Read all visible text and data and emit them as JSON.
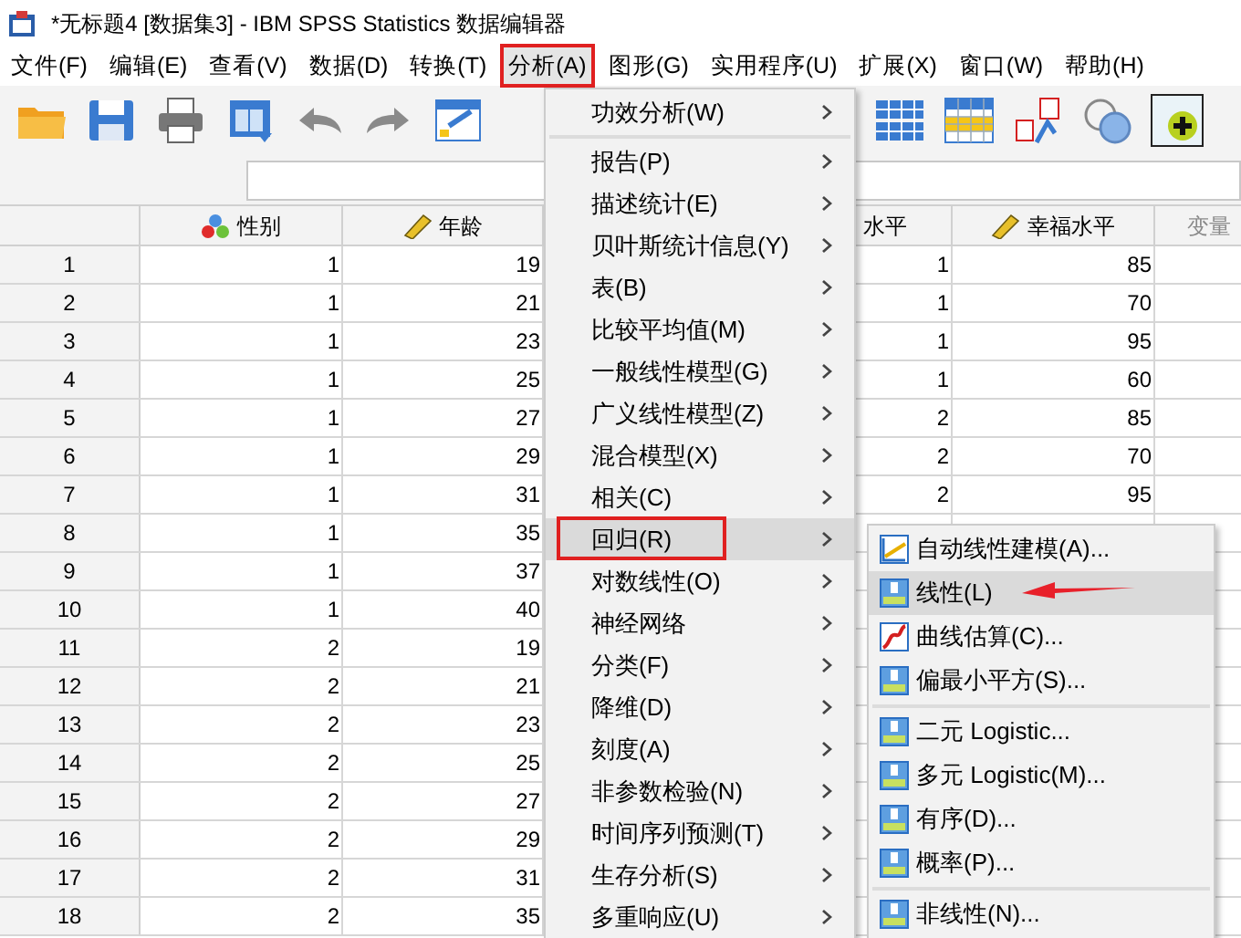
{
  "window": {
    "title": "*无标题4 [数据集3] - IBM SPSS Statistics 数据编辑器"
  },
  "menubar": [
    {
      "label": "文件(F)",
      "selected": false
    },
    {
      "label": "编辑(E)",
      "selected": false
    },
    {
      "label": "查看(V)",
      "selected": false
    },
    {
      "label": "数据(D)",
      "selected": false
    },
    {
      "label": "转换(T)",
      "selected": false
    },
    {
      "label": "分析(A)",
      "selected": true
    },
    {
      "label": "图形(G)",
      "selected": false
    },
    {
      "label": "实用程序(U)",
      "selected": false
    },
    {
      "label": "扩展(X)",
      "selected": false
    },
    {
      "label": "窗口(W)",
      "selected": false
    },
    {
      "label": "帮助(H)",
      "selected": false
    }
  ],
  "grid": {
    "columns": [
      {
        "label": "性别",
        "kind": "nominal"
      },
      {
        "label": "年龄",
        "kind": "scale"
      },
      {
        "label": "水平",
        "kind": "plain"
      },
      {
        "label": "幸福水平",
        "kind": "scale"
      },
      {
        "label": "变量",
        "kind": "empty"
      }
    ],
    "rows": [
      {
        "number": "1",
        "cells": [
          "1",
          "19",
          "1",
          "85"
        ]
      },
      {
        "number": "2",
        "cells": [
          "1",
          "21",
          "1",
          "70"
        ]
      },
      {
        "number": "3",
        "cells": [
          "1",
          "23",
          "1",
          "95"
        ]
      },
      {
        "number": "4",
        "cells": [
          "1",
          "25",
          "1",
          "60"
        ]
      },
      {
        "number": "5",
        "cells": [
          "1",
          "27",
          "2",
          "85"
        ]
      },
      {
        "number": "6",
        "cells": [
          "1",
          "29",
          "2",
          "70"
        ]
      },
      {
        "number": "7",
        "cells": [
          "1",
          "31",
          "2",
          "95"
        ]
      },
      {
        "number": "8",
        "cells": [
          "1",
          "35"
        ]
      },
      {
        "number": "9",
        "cells": [
          "1",
          "37"
        ]
      },
      {
        "number": "10",
        "cells": [
          "1",
          "40"
        ]
      },
      {
        "number": "11",
        "cells": [
          "2",
          "19"
        ]
      },
      {
        "number": "12",
        "cells": [
          "2",
          "21"
        ]
      },
      {
        "number": "13",
        "cells": [
          "2",
          "23"
        ]
      },
      {
        "number": "14",
        "cells": [
          "2",
          "25"
        ]
      },
      {
        "number": "15",
        "cells": [
          "2",
          "27"
        ]
      },
      {
        "number": "16",
        "cells": [
          "2",
          "29"
        ]
      },
      {
        "number": "17",
        "cells": [
          "2",
          "31"
        ]
      },
      {
        "number": "18",
        "cells": [
          "2",
          "35"
        ]
      }
    ]
  },
  "analyze_menu": {
    "items": [
      {
        "label": "功效分析(W)",
        "selected": false,
        "separator_before": false
      },
      {
        "label": "报告(P)",
        "selected": false,
        "separator_before": true
      },
      {
        "label": "描述统计(E)",
        "selected": false,
        "separator_before": false
      },
      {
        "label": "贝叶斯统计信息(Y)",
        "selected": false,
        "separator_before": false
      },
      {
        "label": "表(B)",
        "selected": false,
        "separator_before": false
      },
      {
        "label": "比较平均值(M)",
        "selected": false,
        "separator_before": false
      },
      {
        "label": "一般线性模型(G)",
        "selected": false,
        "separator_before": false
      },
      {
        "label": "广义线性模型(Z)",
        "selected": false,
        "separator_before": false
      },
      {
        "label": "混合模型(X)",
        "selected": false,
        "separator_before": false
      },
      {
        "label": "相关(C)",
        "selected": false,
        "separator_before": false
      },
      {
        "label": "回归(R)",
        "selected": true,
        "separator_before": false
      },
      {
        "label": "对数线性(O)",
        "selected": false,
        "separator_before": false
      },
      {
        "label": "神经网络",
        "selected": false,
        "separator_before": false
      },
      {
        "label": "分类(F)",
        "selected": false,
        "separator_before": false
      },
      {
        "label": "降维(D)",
        "selected": false,
        "separator_before": false
      },
      {
        "label": "刻度(A)",
        "selected": false,
        "separator_before": false
      },
      {
        "label": "非参数检验(N)",
        "selected": false,
        "separator_before": false
      },
      {
        "label": "时间序列预测(T)",
        "selected": false,
        "separator_before": false
      },
      {
        "label": "生存分析(S)",
        "selected": false,
        "separator_before": false
      },
      {
        "label": "多重响应(U)",
        "selected": false,
        "separator_before": false
      }
    ]
  },
  "regression_menu": {
    "items": [
      {
        "label": "自动线性建模(A)...",
        "kind": "auto",
        "selected": false,
        "separator_before": false
      },
      {
        "label": "线性(L)",
        "kind": "r",
        "selected": true,
        "separator_before": false
      },
      {
        "label": "曲线估算(C)...",
        "kind": "curve",
        "selected": false,
        "separator_before": false
      },
      {
        "label": "偏最小平方(S)...",
        "kind": "r",
        "selected": false,
        "separator_before": false
      },
      {
        "label": "二元 Logistic...",
        "kind": "r",
        "selected": false,
        "separator_before": true
      },
      {
        "label": "多元 Logistic(M)...",
        "kind": "r",
        "selected": false,
        "separator_before": false
      },
      {
        "label": "有序(D)...",
        "kind": "r",
        "selected": false,
        "separator_before": false
      },
      {
        "label": "概率(P)...",
        "kind": "r",
        "selected": false,
        "separator_before": false
      },
      {
        "label": "非线性(N)...",
        "kind": "r",
        "selected": false,
        "separator_before": true
      }
    ]
  }
}
